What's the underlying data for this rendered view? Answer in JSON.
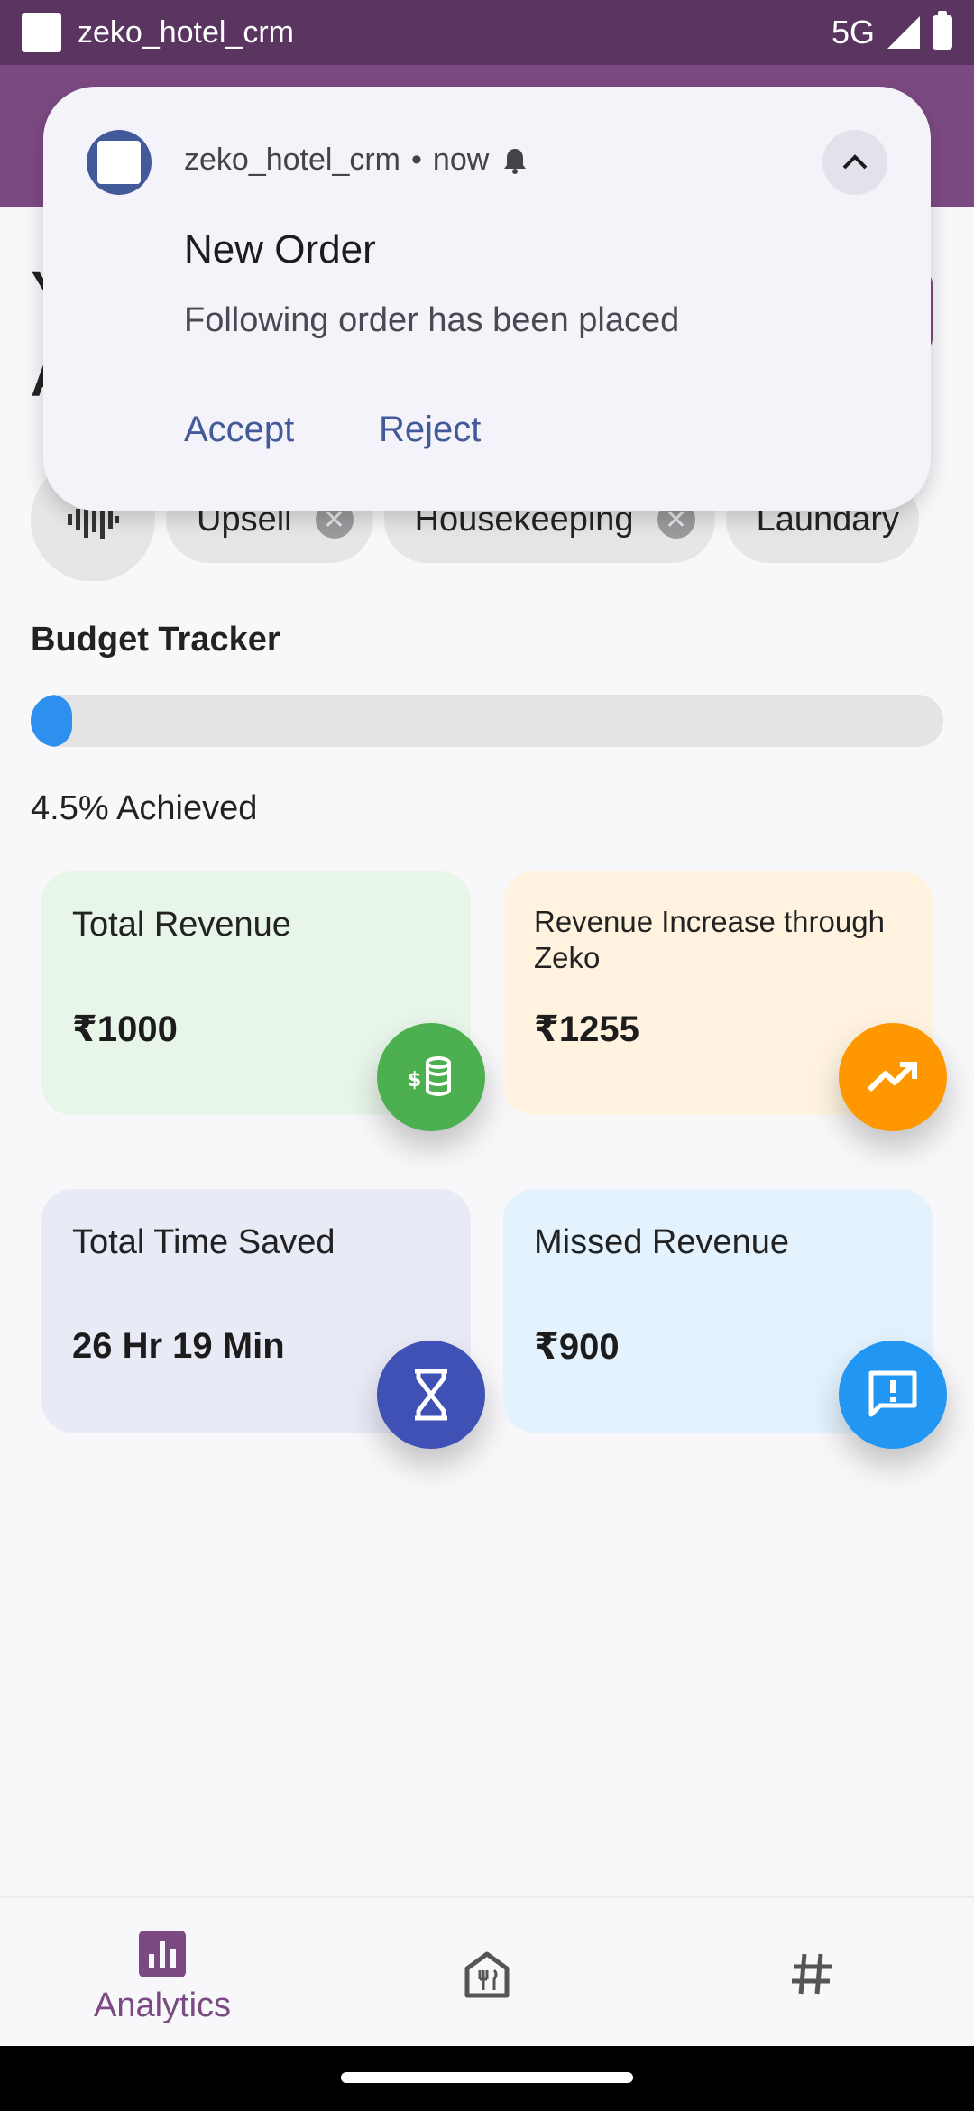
{
  "status_bar": {
    "app_name": "zeko_hotel_crm",
    "network": "5G"
  },
  "background_header": {
    "line1": "Y",
    "line2": "A"
  },
  "chips": [
    "Upsell",
    "Housekeeping",
    "Laundary"
  ],
  "budget": {
    "title": "Budget Tracker",
    "progress_fraction": 0.045,
    "achieved_label": "4.5% Achieved",
    "bar_color": "#2d90ef"
  },
  "cards": [
    {
      "title": "Total Revenue",
      "value": "₹1000",
      "bg": "#e8f5e9",
      "fab_color": "#4caf50",
      "icon": "money-stack-icon"
    },
    {
      "title": "Revenue Increase through Zeko",
      "value": "₹1255",
      "bg": "#fff3e0",
      "fab_color": "#ff9800",
      "icon": "trending-up-icon"
    },
    {
      "title": "Total Time Saved",
      "value": "26 Hr 19 Min",
      "bg": "#e8eaf6",
      "fab_color": "#3f51b5",
      "icon": "hourglass-icon"
    },
    {
      "title": "Missed Revenue",
      "value": "₹900",
      "bg": "#e3f2fd",
      "fab_color": "#2196f3",
      "icon": "feedback-icon"
    }
  ],
  "nav": {
    "items": [
      {
        "label": "Analytics",
        "icon": "analytics-icon"
      },
      {
        "label": "",
        "icon": "restaurant-icon"
      },
      {
        "label": "",
        "icon": "hashtag-icon"
      }
    ],
    "accent": "#7c4a82"
  },
  "notification": {
    "app_name": "zeko_hotel_crm",
    "time": "now",
    "title": "New Order",
    "text": "Following order has been placed",
    "accept_label": "Accept",
    "reject_label": "Reject"
  }
}
